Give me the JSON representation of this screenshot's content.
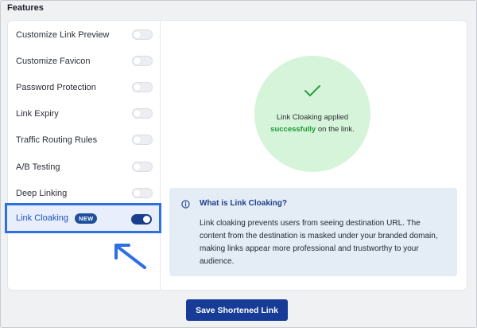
{
  "section": {
    "title": "Features"
  },
  "features": [
    {
      "label": "Customize Link Preview",
      "enabled": false
    },
    {
      "label": "Customize Favicon",
      "enabled": false
    },
    {
      "label": "Password Protection",
      "enabled": false
    },
    {
      "label": "Link Expiry",
      "enabled": false
    },
    {
      "label": "Traffic Routing Rules",
      "enabled": false
    },
    {
      "label": "A/B Testing",
      "enabled": false
    },
    {
      "label": "Deep Linking",
      "enabled": false
    },
    {
      "label": "Link Cloaking",
      "badge": "NEW",
      "enabled": true
    }
  ],
  "success": {
    "line1": "Link Cloaking applied",
    "highlight": "successfully",
    "line2_rest": " on the link."
  },
  "info": {
    "title": "What is Link Cloaking?",
    "body": "Link cloaking prevents users from seeing destination URL. The content from the destination is masked under your branded domain, making links appear more professional and trustworthy to your audience."
  },
  "actions": {
    "save_label": "Save Shortened Link"
  },
  "colors": {
    "accent": "#2f6fe4",
    "toggle_on": "#1a3f8f",
    "success_bg": "#d6f4d9",
    "success_text": "#1f9a3a",
    "info_bg": "#e4ecf6",
    "button": "#163c97"
  },
  "icons": {
    "check": "check-icon",
    "info": "info-icon",
    "pointer": "arrow-pointer-icon"
  }
}
